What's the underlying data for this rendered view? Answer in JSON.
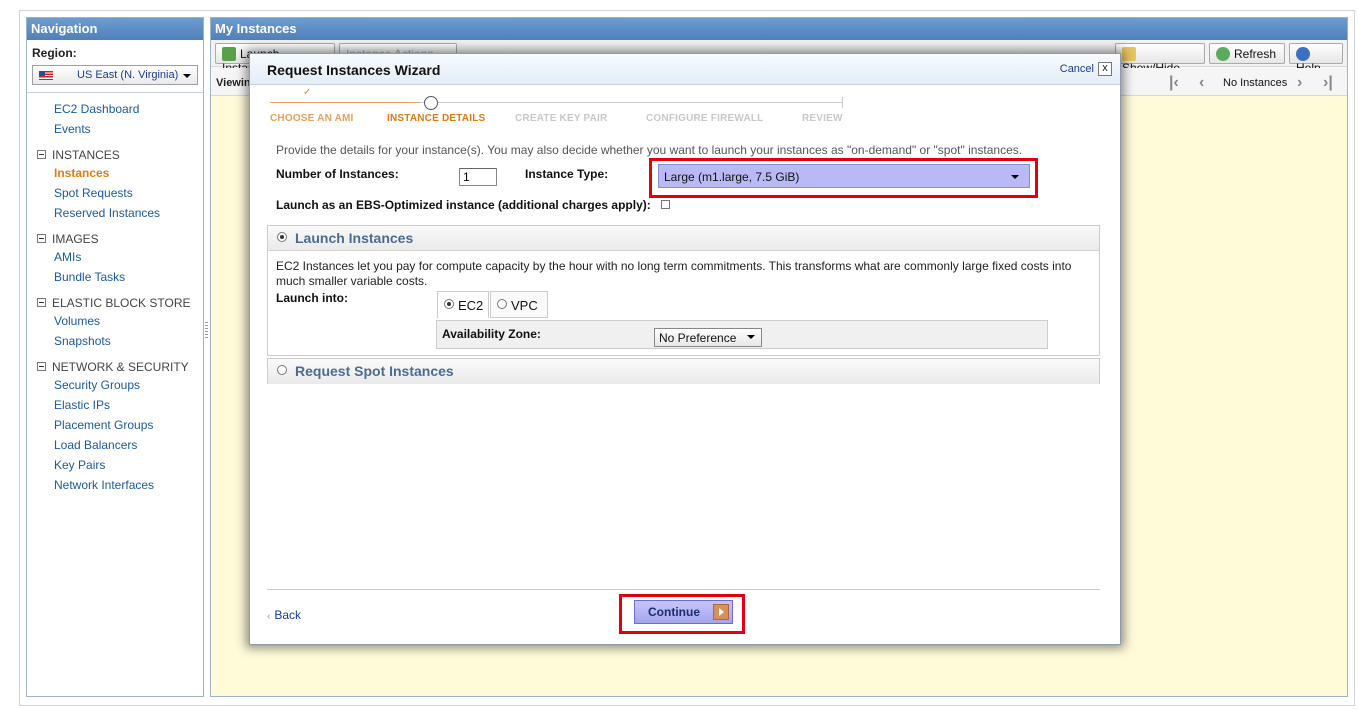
{
  "nav": {
    "title": "Navigation",
    "region_label": "Region:",
    "region_value": "US East (N. Virginia)",
    "dashboard": "EC2 Dashboard",
    "events": "Events",
    "sections": {
      "instances": {
        "title": "INSTANCES",
        "items": [
          "Instances",
          "Spot Requests",
          "Reserved Instances"
        ]
      },
      "images": {
        "title": "IMAGES",
        "items": [
          "AMIs",
          "Bundle Tasks"
        ]
      },
      "ebs": {
        "title": "ELASTIC BLOCK STORE",
        "items": [
          "Volumes",
          "Snapshots"
        ]
      },
      "network": {
        "title": "NETWORK & SECURITY",
        "items": [
          "Security Groups",
          "Elastic IPs",
          "Placement Groups",
          "Load Balancers",
          "Key Pairs",
          "Network Interfaces"
        ]
      }
    }
  },
  "main": {
    "title": "My Instances",
    "toolbar": {
      "launch": "Launch Instance",
      "actions": "Instance Actions",
      "showhide": "Show/Hide",
      "refresh": "Refresh",
      "help": "Help"
    },
    "viewing": "Viewing:",
    "pager_status": "No Instances"
  },
  "wizard": {
    "title": "Request Instances Wizard",
    "cancel": "Cancel",
    "close": "x",
    "steps": [
      "CHOOSE AN AMI",
      "INSTANCE DETAILS",
      "CREATE KEY PAIR",
      "CONFIGURE FIREWALL",
      "REVIEW"
    ],
    "current_step": 1,
    "intro": "Provide the details for your instance(s). You may also decide whether you want to launch your instances as \"on-demand\" or \"spot\" instances.",
    "num_instances_label": "Number of Instances:",
    "num_instances_value": "1",
    "instance_type_label": "Instance Type:",
    "instance_type_value": "Large (m1.large, 7.5 GiB)",
    "ebs_label": "Launch as an EBS-Optimized instance (additional charges apply):",
    "ebs_checked": false,
    "launch_panel": {
      "title": "Launch Instances",
      "selected": true,
      "description": "EC2 Instances let you pay for compute capacity by the hour with no long term commitments. This transforms what are commonly large fixed costs into much smaller variable costs.",
      "launch_into_label": "Launch into:",
      "options": [
        "EC2",
        "VPC"
      ],
      "selected_option": "EC2",
      "az_label": "Availability Zone:",
      "az_value": "No Preference"
    },
    "spot_panel": {
      "title": "Request Spot Instances",
      "selected": false
    },
    "back": "Back",
    "continue": "Continue",
    "highlight_color": "#e00010"
  }
}
